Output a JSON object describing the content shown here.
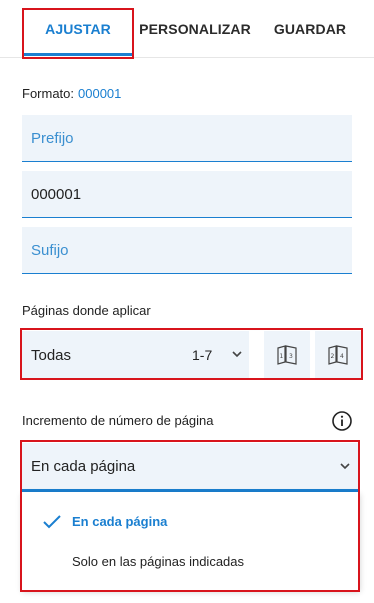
{
  "tabs": [
    {
      "label": "AJUSTAR",
      "active": true
    },
    {
      "label": "PERSONALIZAR",
      "active": false
    },
    {
      "label": "GUARDAR",
      "active": false
    }
  ],
  "format": {
    "label": "Formato:",
    "value": "000001"
  },
  "fields": {
    "prefix": {
      "placeholder": "Prefijo",
      "value": ""
    },
    "number": {
      "value": "000001"
    },
    "suffix": {
      "placeholder": "Sufijo",
      "value": ""
    }
  },
  "pages": {
    "label": "Páginas donde aplicar",
    "selected": "Todas",
    "range": "1-7",
    "buttons": [
      "odd-pages-icon",
      "even-pages-icon"
    ]
  },
  "increment": {
    "label": "Incremento de número de página",
    "selected": "En cada página",
    "options": [
      {
        "label": "En cada página",
        "checked": true
      },
      {
        "label": "Solo en las páginas indicadas",
        "checked": false
      }
    ]
  },
  "colors": {
    "accent": "#1a7fd0",
    "highlight": "#d8141c",
    "field_bg": "#eef4fa"
  }
}
